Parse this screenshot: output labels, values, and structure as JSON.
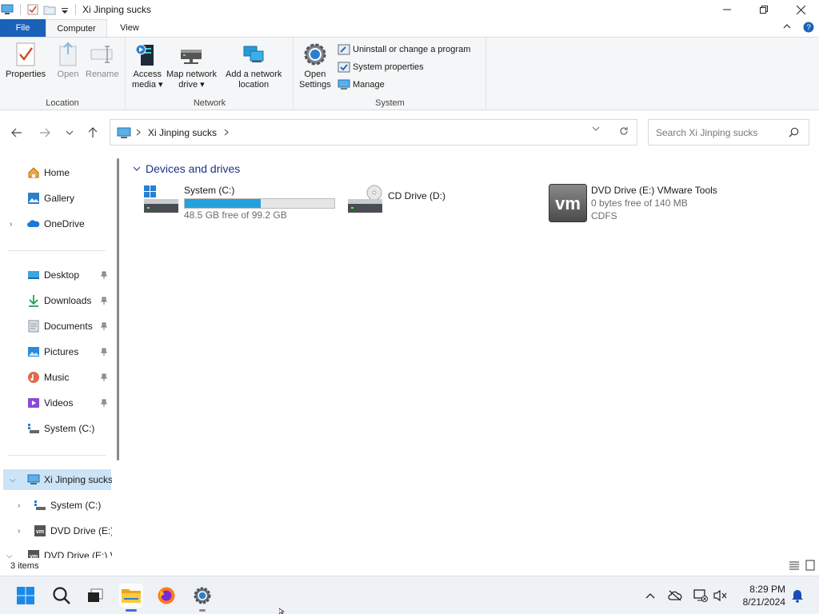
{
  "window": {
    "title": "Xi Jinping sucks"
  },
  "ribbon": {
    "tabs": {
      "file": "File",
      "computer": "Computer",
      "view": "View"
    },
    "location": {
      "label": "Location",
      "properties": "Properties",
      "open": "Open",
      "rename": "Rename"
    },
    "network": {
      "label": "Network",
      "access_media": [
        "Access",
        "media ▾"
      ],
      "map_drive": [
        "Map network",
        "drive ▾"
      ],
      "add_location": [
        "Add a network",
        "location"
      ]
    },
    "system": {
      "label": "System",
      "open_settings": [
        "Open",
        "Settings"
      ],
      "uninstall": "Uninstall or change a program",
      "sys_props": "System properties",
      "manage": "Manage"
    }
  },
  "address": {
    "path": "Xi Jinping sucks",
    "search_placeholder": "Search Xi Jinping sucks"
  },
  "nav": {
    "home": "Home",
    "gallery": "Gallery",
    "onedrive": "OneDrive",
    "desktop": "Desktop",
    "downloads": "Downloads",
    "documents": "Documents",
    "pictures": "Pictures",
    "music": "Music",
    "videos": "Videos",
    "system_c": "System (C:)",
    "this_pc": "Xi Jinping sucks",
    "child_system": "System (C:)",
    "child_dvd": "DVD Drive (E:)",
    "child_dvd_partial": "DVD Drive (E:) V"
  },
  "content": {
    "group": "Devices and drives",
    "drives": [
      {
        "name": "System (C:)",
        "free": "48.5 GB free of 99.2 GB",
        "used_fraction": 0.51
      },
      {
        "name": "CD Drive (D:)"
      },
      {
        "name": "DVD Drive (E:) VMware Tools",
        "free": "0 bytes free of 140 MB",
        "fs": "CDFS",
        "logo": "vm"
      }
    ]
  },
  "status": {
    "count": "3 items"
  },
  "taskbar": {
    "time": "8:29 PM",
    "date": "8/21/2024"
  },
  "colors": {
    "accent": "#1a62b8",
    "selection": "#cce4f7",
    "bar_fill": "#26a0da",
    "group_header": "#1e3287"
  }
}
